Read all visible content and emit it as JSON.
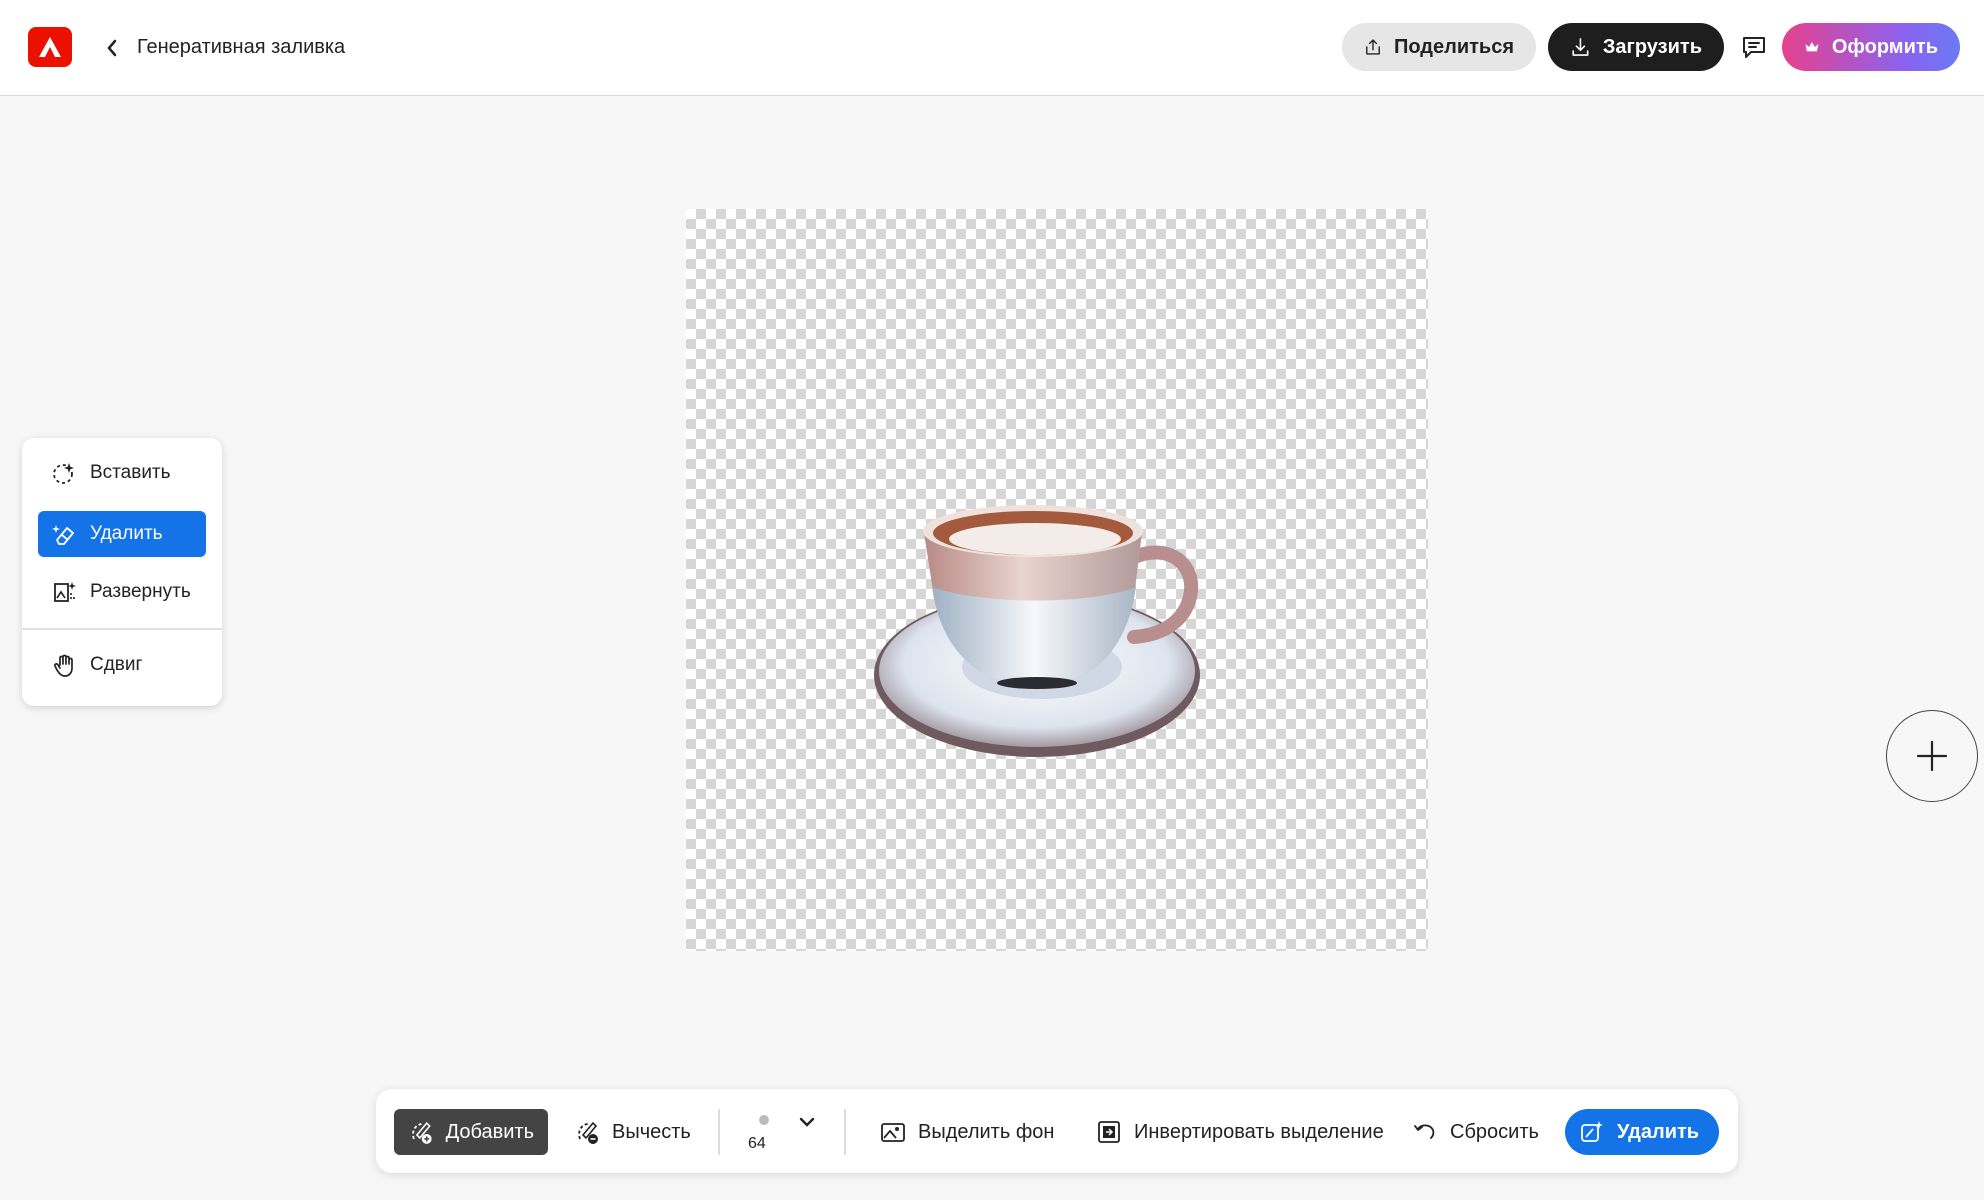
{
  "header": {
    "title": "Генеративная заливка",
    "share_label": "Поделиться",
    "download_label": "Загрузить",
    "premium_label": "Оформить"
  },
  "tools": {
    "items": [
      {
        "label": "Вставить",
        "icon": "insert-icon",
        "active": false
      },
      {
        "label": "Удалить",
        "icon": "remove-icon",
        "active": true
      },
      {
        "label": "Развернуть",
        "icon": "expand-icon",
        "active": false
      },
      {
        "label": "Сдвиг",
        "icon": "hand-icon",
        "active": false
      }
    ]
  },
  "toolbar": {
    "add_label": "Добавить",
    "subtract_label": "Вычесть",
    "brush_size": "64",
    "select_bg_label": "Выделить фон",
    "invert_label": "Инвертировать выделение",
    "reset_label": "Сбросить",
    "remove_label": "Удалить"
  },
  "colors": {
    "accent": "#1473e6",
    "brand": "#eb1000",
    "dark": "#1e1e1e"
  }
}
